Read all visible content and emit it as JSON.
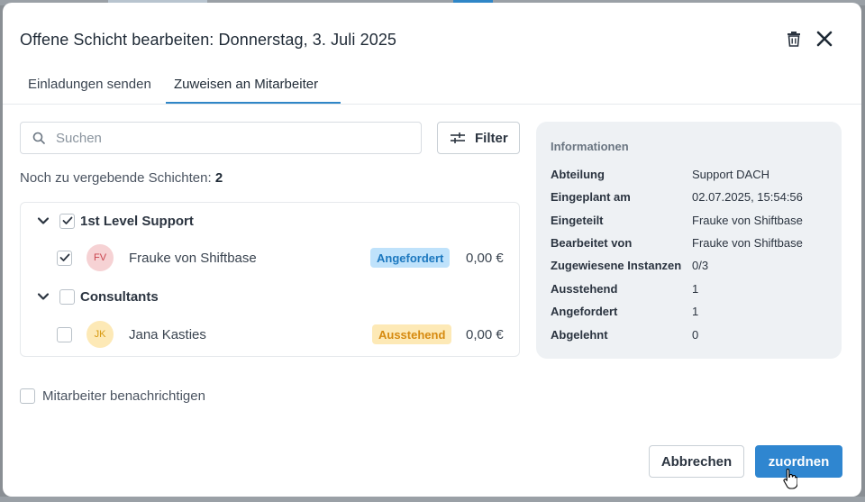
{
  "dialog": {
    "title": "Offene Schicht bearbeiten: Donnerstag, 3. Juli 2025",
    "icons": {
      "delete": "trash-icon",
      "close": "close-icon"
    }
  },
  "tabs": [
    {
      "label": "Einladungen senden",
      "active": false
    },
    {
      "label": "Zuweisen an Mitarbeiter",
      "active": true
    }
  ],
  "search": {
    "placeholder": "Suchen",
    "value": ""
  },
  "filter": {
    "label": "Filter"
  },
  "remaining": {
    "label": "Noch zu vergebende Schichten:",
    "count": "2"
  },
  "groups": [
    {
      "name": "1st Level Support",
      "checked": true,
      "expanded": true,
      "employees": [
        {
          "initials": "FV",
          "name": "Frauke von Shiftbase",
          "status": "Angefordert",
          "price": "0,00 €",
          "checked": true
        }
      ]
    },
    {
      "name": "Consultants",
      "checked": false,
      "expanded": true,
      "employees": [
        {
          "initials": "JK",
          "name": "Jana Kasties",
          "status": "Ausstehend",
          "price": "0,00 €",
          "checked": false
        }
      ]
    }
  ],
  "info": {
    "title": "Informationen",
    "rows": [
      {
        "label": "Abteilung",
        "value": "Support DACH"
      },
      {
        "label": "Eingeplant am",
        "value": "02.07.2025, 15:54:56"
      },
      {
        "label": "Eingeteilt",
        "value": "Frauke von Shiftbase"
      },
      {
        "label": "Bearbeitet von",
        "value": "Frauke von Shiftbase"
      },
      {
        "label": "Zugewiesene Instanzen",
        "value": "0/3"
      },
      {
        "label": "Ausstehend",
        "value": "1"
      },
      {
        "label": "Angefordert",
        "value": "1"
      },
      {
        "label": "Abgelehnt",
        "value": "0"
      }
    ]
  },
  "notify": {
    "label": "Mitarbeiter benachrichtigen",
    "checked": false
  },
  "actions": {
    "cancel": "Abbrechen",
    "assign": "zuordnen"
  },
  "colors": {
    "accent": "#2f86d0",
    "requested_badge": "#bfe2fb",
    "pending_badge": "#fde9b6"
  }
}
